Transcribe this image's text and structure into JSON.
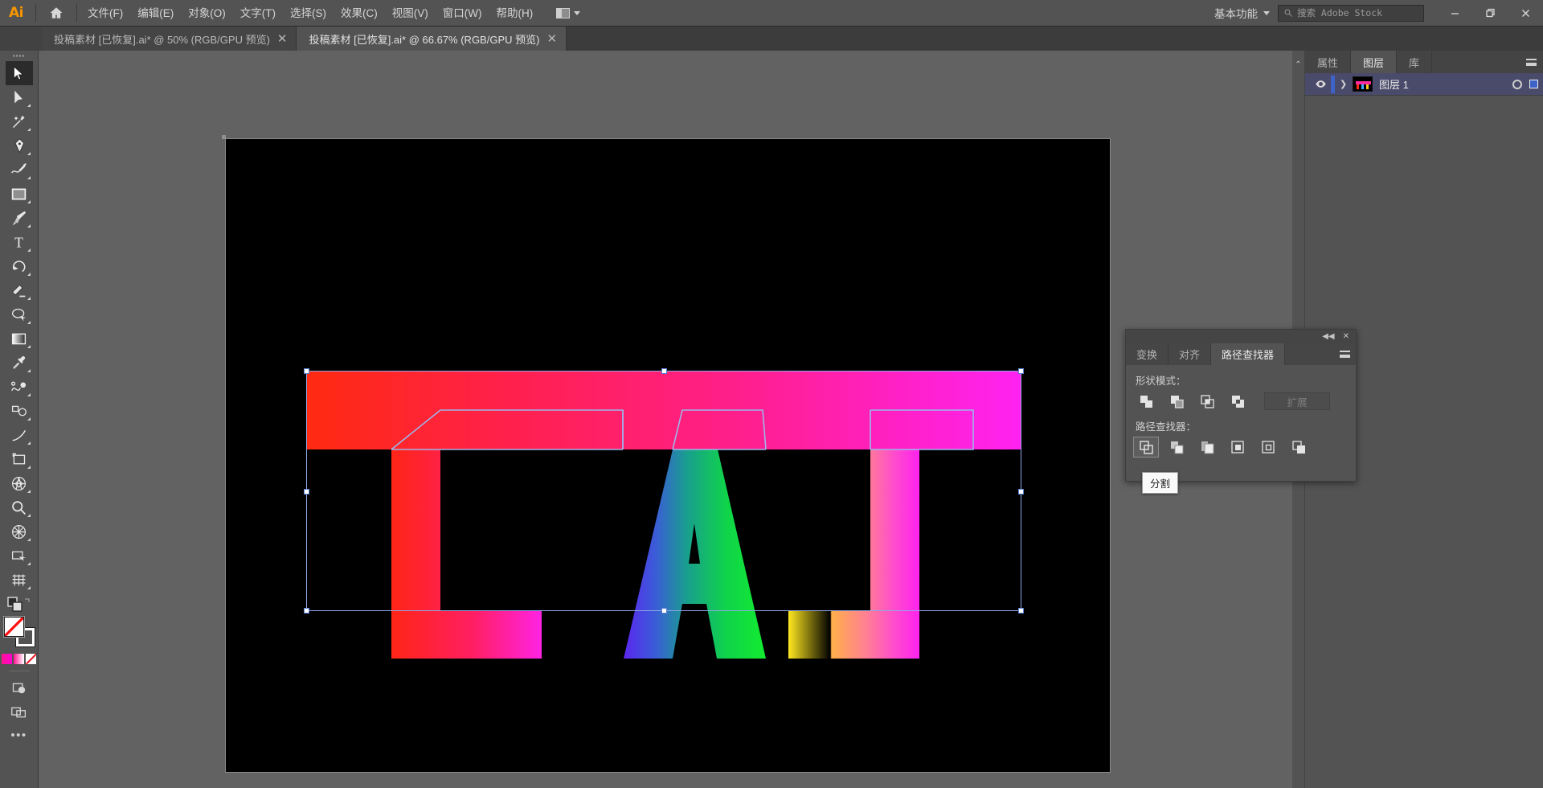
{
  "app": {
    "name": "Adobe Illustrator",
    "logo_text": "Ai",
    "accent": "#f79500"
  },
  "menubar": {
    "home_icon": "home-icon",
    "items": [
      {
        "label": "文件(F)"
      },
      {
        "label": "编辑(E)"
      },
      {
        "label": "对象(O)"
      },
      {
        "label": "文字(T)"
      },
      {
        "label": "选择(S)"
      },
      {
        "label": "效果(C)"
      },
      {
        "label": "视图(V)"
      },
      {
        "label": "窗口(W)"
      },
      {
        "label": "帮助(H)"
      }
    ],
    "arrange_documents_icon": "arrange-documents-icon",
    "workspace": "基本功能",
    "search_placeholder": "搜索 Adobe Stock",
    "window_controls": {
      "minimize": "minimize-icon",
      "restore": "restore-icon",
      "close": "close-icon"
    }
  },
  "tabs": [
    {
      "title": "投稿素材 [已恢复].ai* @ 50% (RGB/GPU 预览)",
      "active": false,
      "close": "✕"
    },
    {
      "title": "投稿素材 [已恢复].ai* @ 66.67% (RGB/GPU 预览)",
      "active": true,
      "close": "✕"
    }
  ],
  "toolbar": {
    "grip": "▪▪▪▪",
    "tools": [
      {
        "name": "selection-tool",
        "label": "选择工具",
        "active": true
      },
      {
        "name": "direct-selection-tool",
        "label": "直接选择工具",
        "active": false
      },
      {
        "name": "magic-wand-tool",
        "label": "魔棒工具",
        "active": false
      },
      {
        "name": "pen-tool",
        "label": "钢笔工具",
        "active": false
      },
      {
        "name": "curvature-tool",
        "label": "曲率工具",
        "active": false
      },
      {
        "name": "rectangle-tool",
        "label": "矩形工具",
        "active": false
      },
      {
        "name": "paintbrush-tool",
        "label": "画笔工具",
        "active": false
      },
      {
        "name": "type-tool",
        "label": "文字工具",
        "active": false
      },
      {
        "name": "rotate-tool",
        "label": "旋转工具",
        "active": false
      },
      {
        "name": "eraser-tool",
        "label": "橡皮擦工具",
        "active": false
      },
      {
        "name": "shaper-tool",
        "label": "Shaper 工具",
        "active": false
      },
      {
        "name": "gradient-tool",
        "label": "渐变工具",
        "active": false
      },
      {
        "name": "eyedropper-tool",
        "label": "吸管工具",
        "active": false
      },
      {
        "name": "blend-tool",
        "label": "混合工具",
        "active": false
      },
      {
        "name": "symbol-sprayer-tool",
        "label": "符号喷枪工具",
        "active": false
      },
      {
        "name": "line-segment-tool",
        "label": "直线段工具",
        "active": false
      },
      {
        "name": "artboard-tool",
        "label": "画板工具",
        "active": false
      },
      {
        "name": "perspective-grid-tool",
        "label": "透视网格工具",
        "active": false
      },
      {
        "name": "zoom-tool",
        "label": "缩放工具",
        "active": false
      },
      {
        "name": "shape-builder-tool",
        "label": "形状生成器工具",
        "active": false
      },
      {
        "name": "slice-tool",
        "label": "切片工具",
        "active": false
      },
      {
        "name": "gradient-mesh-tool",
        "label": "网格工具",
        "active": false
      }
    ],
    "swatches": {
      "fill_color": "#ffffff",
      "stroke_color": "#ffffff",
      "gradient_preview": "#ff1493",
      "more_dots": "•••"
    }
  },
  "canvas": {
    "artboard_background": "#000000",
    "zoom": "66.67%",
    "selection_color": "#8ea8e8"
  },
  "artwork": {
    "title": "LAJ",
    "band": {
      "from": "#ff2a10",
      "via": "#ff1f6b",
      "to": "#ff22ee"
    },
    "letters": [
      {
        "char": "L",
        "gradient_from": "#ff2516",
        "gradient_to": "#ff23e4"
      },
      {
        "char": "A",
        "gradient_from": "#4b2ff0",
        "gradient_to": "#15e83a"
      },
      {
        "char": "J",
        "gradient_from": "#ffe820",
        "gradient_to": "#ff22ee"
      }
    ]
  },
  "right_dock": {
    "collapse_icon": "chevron-collapse-icon",
    "tabs": [
      {
        "label": "属性",
        "active": false
      },
      {
        "label": "图层",
        "active": true
      },
      {
        "label": "库",
        "active": false
      }
    ],
    "panel_menu_icon": "panel-menu-icon",
    "layers": [
      {
        "name": "图层 1",
        "visible": true,
        "expanded": false,
        "expand_arrow": "❯",
        "eye_icon": "eye-icon",
        "target_icon": "target-circle-icon",
        "selected": true
      }
    ]
  },
  "pathfinder_panel": {
    "titlebar": {
      "collapse_icon": "collapse-to-icons-icon",
      "close_icon": "close-icon"
    },
    "tabs": [
      {
        "label": "变换",
        "active": false
      },
      {
        "label": "对齐",
        "active": false
      },
      {
        "label": "路径查找器",
        "active": true
      }
    ],
    "panel_menu_icon": "panel-menu-icon",
    "shape_modes_label": "形状模式：",
    "shape_modes": [
      {
        "name": "unite-icon",
        "label": "联集"
      },
      {
        "name": "minus-front-icon",
        "label": "减去顶层"
      },
      {
        "name": "intersect-icon",
        "label": "交集"
      },
      {
        "name": "exclude-icon",
        "label": "差集"
      }
    ],
    "expand_button": {
      "label": "扩展",
      "disabled": true
    },
    "pathfinders_label": "路径查找器：",
    "pathfinders": [
      {
        "name": "divide-icon",
        "label": "分割",
        "hovered": true
      },
      {
        "name": "trim-icon",
        "label": "修边",
        "hovered": false
      },
      {
        "name": "merge-icon",
        "label": "合并",
        "hovered": false
      },
      {
        "name": "crop-icon",
        "label": "裁剪",
        "hovered": false
      },
      {
        "name": "outline-icon",
        "label": "轮廓",
        "hovered": false
      },
      {
        "name": "minus-back-icon",
        "label": "减去后方对象",
        "hovered": false
      }
    ],
    "tooltip": "分割"
  }
}
